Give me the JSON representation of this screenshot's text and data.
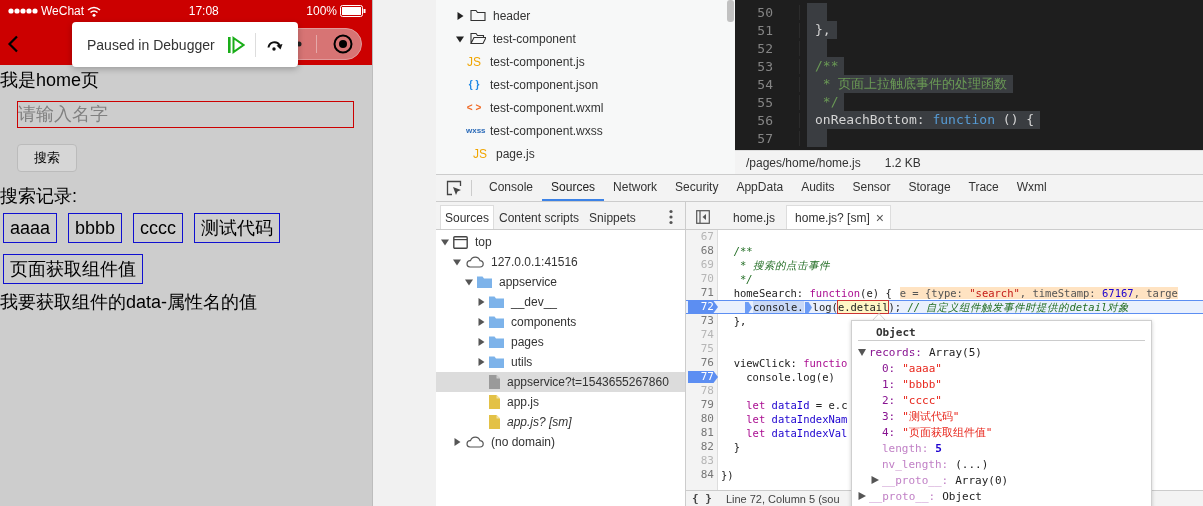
{
  "phone": {
    "status_bar": {
      "carrier": "WeChat",
      "time": "17:08",
      "battery": "100%"
    },
    "debugger_popup": {
      "label": "Paused in Debugger"
    },
    "page": {
      "title": "我是home页",
      "input": {
        "placeholder": "请输入名字"
      },
      "search_button": "搜索",
      "history_label": "搜索记录:",
      "history": [
        "aaaa",
        "bbbb",
        "cccc",
        "测试代码",
        "页面获取组件值"
      ],
      "footer": "我要获取组件的data-属性名的值"
    }
  },
  "file_tree": [
    {
      "name": "header",
      "kind": "folder",
      "expanded": false
    },
    {
      "name": "test-component",
      "kind": "folder",
      "expanded": true,
      "children": [
        {
          "name": "test-component.js",
          "kind": "js",
          "badge": "JS"
        },
        {
          "name": "test-component.json",
          "kind": "json",
          "badge": "{ }"
        },
        {
          "name": "test-component.wxml",
          "kind": "wxml",
          "badge": "< >"
        },
        {
          "name": "test-component.wxss",
          "kind": "wxss",
          "badge": "wxss"
        }
      ]
    },
    {
      "name": "page.js",
      "kind": "js",
      "badge": "JS"
    }
  ],
  "top_editor": {
    "lines": [
      {
        "n": "50",
        "selected": true
      },
      {
        "n": "51",
        "selected": true,
        "tokens": [
          {
            "t": "},",
            "kind": "plain"
          }
        ]
      },
      {
        "n": "52",
        "selected": true
      },
      {
        "n": "53",
        "selected": true,
        "tokens": [
          {
            "t": "/**",
            "kind": "comment"
          }
        ]
      },
      {
        "n": "54",
        "selected": true,
        "tokens": [
          {
            "t": " * 页面上拉触底事件的处理函数",
            "kind": "comment"
          }
        ]
      },
      {
        "n": "55",
        "selected": true,
        "tokens": [
          {
            "t": " */",
            "kind": "comment"
          }
        ]
      },
      {
        "n": "56",
        "selected": true,
        "tokens": [
          {
            "t": "onReachBottom: ",
            "kind": "plain"
          },
          {
            "t": "function",
            "kind": "keyword"
          },
          {
            "t": " () {",
            "kind": "plain"
          }
        ]
      },
      {
        "n": "57",
        "selected": true
      }
    ],
    "status": {
      "path": "/pages/home/home.js",
      "size": "1.2 KB"
    }
  },
  "devtools": {
    "tabs": [
      {
        "label": "Console",
        "selected": false
      },
      {
        "label": "Sources",
        "selected": true
      },
      {
        "label": "Network",
        "selected": false
      },
      {
        "label": "Security",
        "selected": false
      },
      {
        "label": "AppData",
        "selected": false
      },
      {
        "label": "Audits",
        "selected": false
      },
      {
        "label": "Sensor",
        "selected": false
      },
      {
        "label": "Storage",
        "selected": false
      },
      {
        "label": "Trace",
        "selected": false
      },
      {
        "label": "Wxml",
        "selected": false
      }
    ],
    "navigator": {
      "tabs": [
        {
          "label": "Sources",
          "selected": true
        },
        {
          "label": "Content scripts",
          "selected": false
        },
        {
          "label": "Snippets",
          "selected": false
        }
      ],
      "tree": [
        {
          "label": "top",
          "kind": "frame",
          "expanded": true,
          "selected": false,
          "children": [
            {
              "label": "127.0.0.1:41516",
              "kind": "domain",
              "expanded": true,
              "selected": false,
              "children": [
                {
                  "label": "appservice",
                  "kind": "folder",
                  "expanded": true,
                  "selected": false,
                  "children": [
                    {
                      "label": "__dev__",
                      "kind": "folder",
                      "expanded": false,
                      "selected": false
                    },
                    {
                      "label": "components",
                      "kind": "folder",
                      "expanded": false,
                      "selected": false
                    },
                    {
                      "label": "pages",
                      "kind": "folder",
                      "expanded": false,
                      "selected": false
                    },
                    {
                      "label": "utils",
                      "kind": "folder",
                      "expanded": false,
                      "selected": false
                    },
                    {
                      "label": "appservice?t=1543655267860",
                      "kind": "resource",
                      "sourcemapped": false,
                      "selected": true
                    },
                    {
                      "label": "app.js",
                      "kind": "script",
                      "sourcemapped": false,
                      "selected": false
                    },
                    {
                      "label": "app.js? [sm]",
                      "kind": "script",
                      "sourcemapped": true,
                      "selected": false
                    }
                  ]
                }
              ]
            },
            {
              "label": "(no domain)",
              "kind": "domain",
              "expanded": false,
              "selected": false
            }
          ]
        }
      ]
    },
    "editor": {
      "tabs": [
        {
          "label": "home.js",
          "selected": false
        },
        {
          "label": "home.js? [sm]",
          "selected": true,
          "close": "×"
        }
      ],
      "lines": [
        {
          "n": "67",
          "dim": true,
          "breakpoint": false,
          "current": false
        },
        {
          "n": "68",
          "dim": false,
          "breakpoint": false,
          "current": false,
          "tokens": [
            {
              "t": "  /**",
              "kind": "comment"
            }
          ]
        },
        {
          "n": "69",
          "dim": true,
          "breakpoint": false,
          "current": false,
          "tokens": [
            {
              "t": "   * 搜索的点击事件",
              "kind": "comment"
            }
          ]
        },
        {
          "n": "70",
          "dim": true,
          "breakpoint": false,
          "current": false,
          "tokens": [
            {
              "t": "   */",
              "kind": "comment"
            }
          ]
        },
        {
          "n": "71",
          "dim": false,
          "breakpoint": false,
          "current": false,
          "tokens": [
            {
              "t": "  homeSearch: ",
              "kind": "plain"
            },
            {
              "t": "function",
              "kind": "keyword"
            },
            {
              "t": "(e) {",
              "kind": "plain"
            }
          ],
          "inline": [
            {
              "t": "e = {type: ",
              "kind": "plain"
            },
            {
              "t": "\"search\"",
              "kind": "string"
            },
            {
              "t": ", timeStamp: ",
              "kind": "plain"
            },
            {
              "t": "67167",
              "kind": "number"
            },
            {
              "t": ", targe",
              "kind": "plain"
            }
          ]
        },
        {
          "n": "72",
          "dim": false,
          "breakpoint": true,
          "current": true,
          "tokens": [
            {
              "kind": "marker"
            },
            {
              "t": "console.",
              "kind": "active"
            },
            {
              "kind": "marker"
            },
            {
              "t": "log(",
              "kind": "plain"
            },
            {
              "t": "e.detail",
              "kind": "hover"
            },
            {
              "t": "); ",
              "kind": "plain"
            },
            {
              "t": "// 自定义组件触发事件时提供的detail对象",
              "kind": "comment"
            }
          ]
        },
        {
          "n": "73",
          "dim": false,
          "breakpoint": false,
          "current": false,
          "tokens": [
            {
              "t": "  },",
              "kind": "plain"
            }
          ]
        },
        {
          "n": "74",
          "dim": true,
          "breakpoint": false,
          "current": false
        },
        {
          "n": "75",
          "dim": true,
          "breakpoint": false,
          "current": false
        },
        {
          "n": "76",
          "dim": false,
          "breakpoint": false,
          "current": false,
          "tokens": [
            {
              "t": "  viewClick: ",
              "kind": "plain"
            },
            {
              "t": "functio",
              "kind": "keyword"
            }
          ]
        },
        {
          "n": "77",
          "dim": false,
          "breakpoint": true,
          "current": false,
          "tokens": [
            {
              "t": "    console.log(e)",
              "kind": "plain"
            }
          ]
        },
        {
          "n": "78",
          "dim": true,
          "breakpoint": false,
          "current": false
        },
        {
          "n": "79",
          "dim": false,
          "breakpoint": false,
          "current": false,
          "tokens": [
            {
              "t": "    let",
              "kind": "keyword"
            },
            {
              "t": " dataId",
              "kind": "variable"
            },
            {
              "t": " = e.c",
              "kind": "plain"
            }
          ]
        },
        {
          "n": "80",
          "dim": false,
          "breakpoint": false,
          "current": false,
          "tokens": [
            {
              "t": "    let",
              "kind": "keyword"
            },
            {
              "t": " dataIndexNam",
              "kind": "variable"
            }
          ]
        },
        {
          "n": "81",
          "dim": false,
          "breakpoint": false,
          "current": false,
          "tokens": [
            {
              "t": "    let",
              "kind": "keyword"
            },
            {
              "t": " dataIndexVal",
              "kind": "variable"
            }
          ]
        },
        {
          "n": "82",
          "dim": false,
          "breakpoint": false,
          "current": false,
          "tokens": [
            {
              "t": "  }",
              "kind": "plain"
            }
          ]
        },
        {
          "n": "83",
          "dim": true,
          "breakpoint": false,
          "current": false
        },
        {
          "n": "84",
          "dim": false,
          "breakpoint": false,
          "current": false,
          "tokens": [
            {
              "t": "})",
              "kind": "plain"
            }
          ]
        }
      ],
      "popover": {
        "title": "Object",
        "props": [
          {
            "key": "records:",
            "value": "Array(5)",
            "kind": "plain",
            "dim": false,
            "expanded": true,
            "children": [
              {
                "key": "0:",
                "value": "\"aaaa\"",
                "kind": "string",
                "dim": false
              },
              {
                "key": "1:",
                "value": "\"bbbb\"",
                "kind": "string",
                "dim": false
              },
              {
                "key": "2:",
                "value": "\"cccc\"",
                "kind": "string",
                "dim": false
              },
              {
                "key": "3:",
                "value": "\"测试代码\"",
                "kind": "string",
                "dim": false
              },
              {
                "key": "4:",
                "value": "\"页面获取组件值\"",
                "kind": "string",
                "dim": false
              },
              {
                "key": "length:",
                "value": "5",
                "kind": "number",
                "dim": true
              },
              {
                "key": "nv_length:",
                "value": "(...)",
                "kind": "plain",
                "dim": true
              },
              {
                "key": "__proto__:",
                "value": "Array(0)",
                "kind": "plain",
                "dim": true,
                "expanded": false
              }
            ]
          },
          {
            "key": "__proto__:",
            "value": "Object",
            "kind": "plain",
            "dim": true,
            "expanded": false
          }
        ]
      },
      "status": {
        "format": "{ }",
        "position": "Line 72, Column 5  (sou"
      }
    }
  }
}
